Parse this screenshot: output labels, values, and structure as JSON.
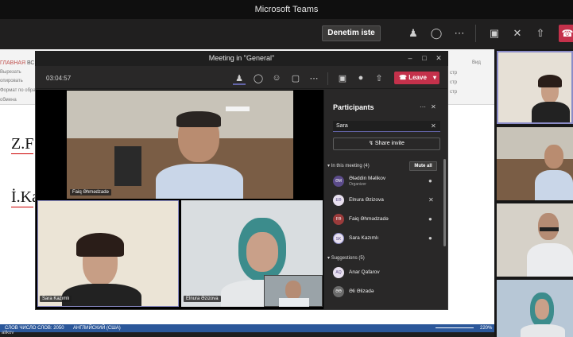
{
  "app_title": "Microsoft Teams",
  "top_bar": {
    "denetim_label": "Denetim iste",
    "icons": [
      "people-icon",
      "chat-bubbles-icon",
      "more-icon",
      "camera-icon",
      "mic-off-icon",
      "share-icon",
      "hangup-icon"
    ]
  },
  "word": {
    "tab_labels": [
      "ГЛАВНАЯ",
      "ВС"
    ],
    "ribbon_lines": [
      "Вырезать",
      "опировать",
      "Формат по образ",
      "обмена"
    ],
    "right_ribbon": [
      "Вид"
    ],
    "right_ribbon_lines": [
      "стр",
      "стр",
      "стр"
    ],
    "body_lines": [
      "Z.F",
      "İ.Ka"
    ],
    "status_left": "СЛОВ ЧИСЛО СЛОВ: 2050",
    "status_lang": "АНГЛИЙСКИЙ (США)",
    "status_zoom": "220%",
    "bottom_name": "alikov"
  },
  "meeting": {
    "title": "Meeting in \"General\"",
    "timer": "03:04:57",
    "leave_label": "Leave",
    "tiles": [
      {
        "name": "Faiq Əhmədzadə"
      },
      {
        "name": "Sara Kazımlı"
      },
      {
        "name": "Elnura Əzizova"
      }
    ]
  },
  "participants": {
    "title": "Participants",
    "search_value": "Sara",
    "share_invite": "Share invite",
    "in_meeting_label": "In this meeting (4)",
    "mute_all": "Mute all",
    "in_meeting": [
      {
        "name": "Ələddin Məlikov",
        "sub": "Organizer",
        "initials": "ƏM",
        "color": "#5b4b8a"
      },
      {
        "name": "Elnura Əzizova",
        "sub": "",
        "initials": "EƏ",
        "color": "#e8e0ef"
      },
      {
        "name": "Faiq Əhmədzadə",
        "sub": "",
        "initials": "FƏ",
        "color": "#9b3b3b"
      },
      {
        "name": "Sara Kazımlı",
        "sub": "",
        "initials": "SK",
        "color": "#e8e0ef"
      }
    ],
    "suggestions_label": "Suggestions (5)",
    "suggestions": [
      {
        "name": "Anar Qafarov",
        "initials": "AQ",
        "color": "#e8e0ef"
      },
      {
        "name": "Əli Əlizadə",
        "initials": "ƏƏ",
        "color": "#6b6b6b"
      }
    ]
  },
  "colors": {
    "accent": "#6264a7",
    "leave": "#c4314b",
    "word_blue": "#2b579a"
  }
}
